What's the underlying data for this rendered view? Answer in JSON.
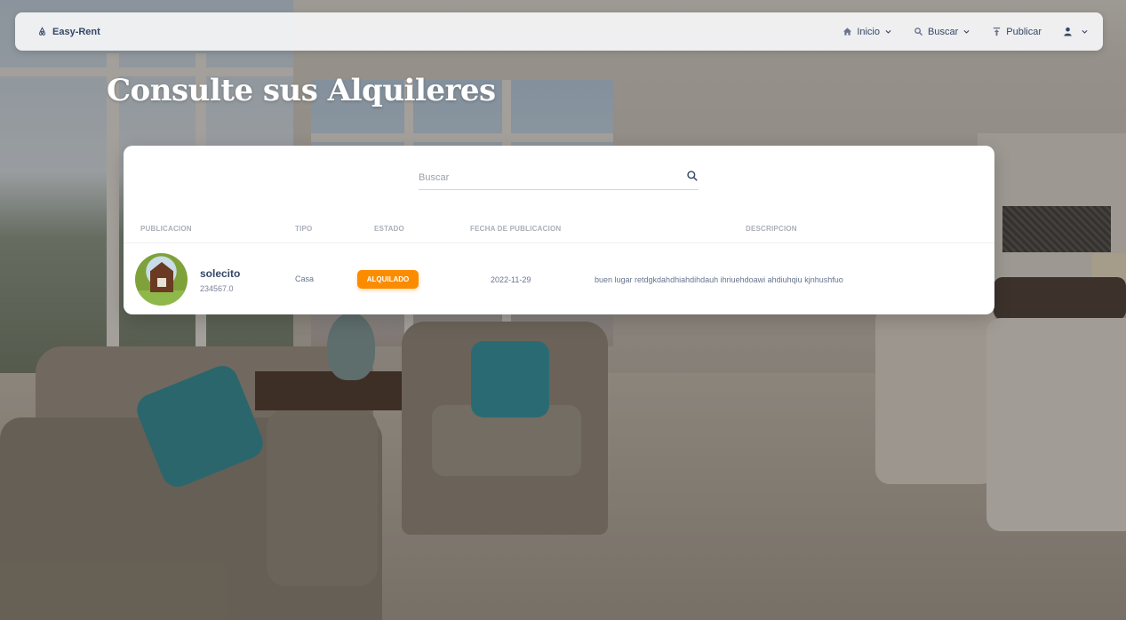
{
  "navbar": {
    "brand": "Easy-Rent",
    "items": [
      {
        "label": "Inicio",
        "icon": "home-icon"
      },
      {
        "label": "Buscar",
        "icon": "search-icon"
      },
      {
        "label": "Publicar",
        "icon": "upload-icon"
      }
    ],
    "user_icon": "user-icon"
  },
  "page": {
    "title": "Consulte sus Alquileres"
  },
  "search": {
    "placeholder": "Buscar",
    "value": ""
  },
  "table": {
    "columns": [
      "PUBLICACION",
      "TIPO",
      "ESTADO",
      "FECHA DE PUBLICACION",
      "DESCRIPCION"
    ],
    "rows": [
      {
        "name": "solecito",
        "price": "234567.0",
        "tipo": "Casa",
        "estado": "ALQUILADO",
        "fecha": "2022-11-29",
        "descripcion": "buen lugar retdgkdahdhiahdihdauh ihriuehdoawi ahdiuhqiu kjnhushfuo"
      }
    ]
  },
  "colors": {
    "badge": "#fb8c00",
    "text_primary": "#344767",
    "text_secondary": "#67748e"
  }
}
